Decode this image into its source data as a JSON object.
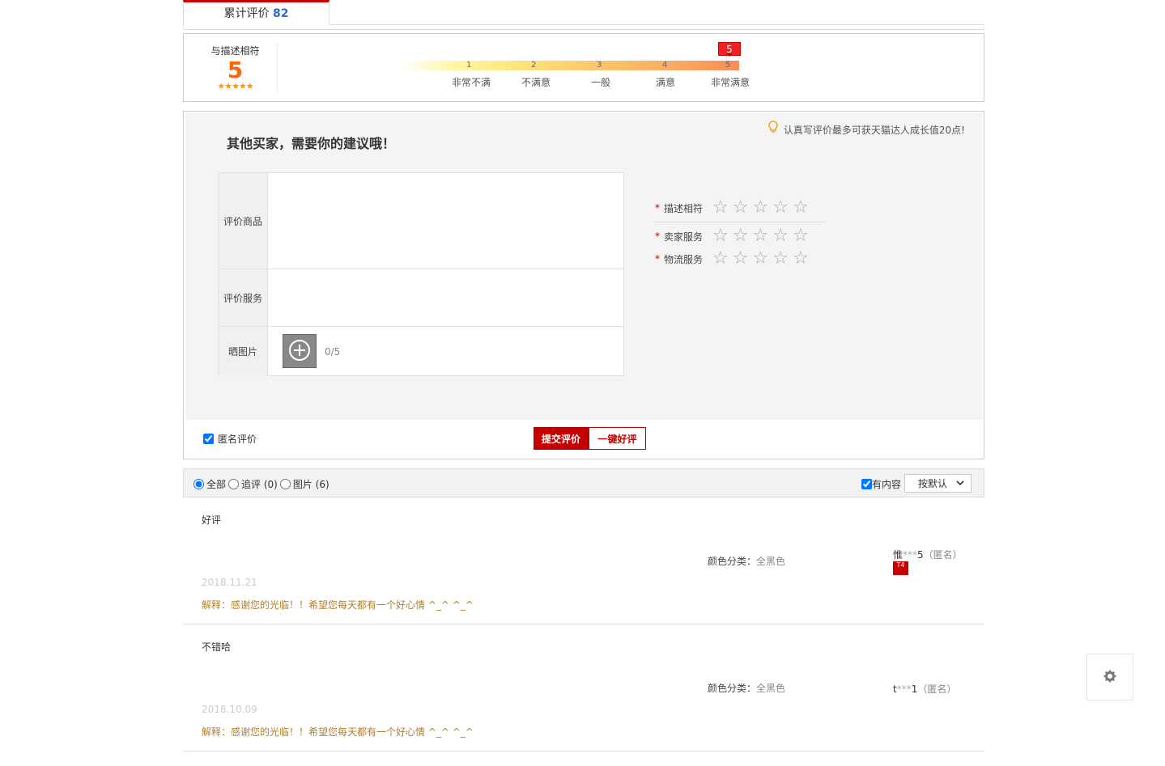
{
  "tab": {
    "label": "累计评价",
    "count": "82"
  },
  "score": {
    "label": "与描述相符",
    "value": "5",
    "stars": "★★★★★",
    "marker": "5",
    "scale_numbers": [
      "1",
      "2",
      "3",
      "4",
      "5"
    ],
    "scale_labels": [
      "非常不满",
      "不满意",
      "一般",
      "满意",
      "非常满意"
    ]
  },
  "form": {
    "title": "其他买家，需要你的建议哦！",
    "tip": "认真写评价最多可获天猫达人成长值20点!",
    "rows": {
      "product": "评价商品",
      "service": "评价服务",
      "photos": "晒图片"
    },
    "photo_count": "0/5",
    "ratings": [
      "描述相符",
      "卖家服务",
      "物流服务"
    ],
    "required_mark": "*",
    "star_glyph": "☆",
    "anonymous": "匿名评价",
    "submit": "提交评价",
    "one_click": "一键好评"
  },
  "filters": {
    "all": "全部",
    "append": "追评 (0)",
    "images": "图片 (6)",
    "has_content": "有内容",
    "sort": "按默认"
  },
  "reviews": [
    {
      "content": "好评",
      "date": "2018.11.21",
      "reply": "解释：感谢您的光临！！希望您每天都有一个好心情 ^_^ ^_^",
      "sku_key": "颜色分类：",
      "sku_val": "全黑色",
      "user_a": "惟",
      "user_mask": "***",
      "user_b": "5",
      "anon": "（匿名）",
      "badge": "T4"
    },
    {
      "content": "不错哈",
      "date": "2018.10.09",
      "reply": "解释：感谢您的光临！！希望您每天都有一个好心情 ^_^ ^_^",
      "sku_key": "颜色分类：",
      "sku_val": "全黑色",
      "user_a": "t",
      "user_mask": "***",
      "user_b": "1",
      "anon": "（匿名）"
    }
  ],
  "colors": {
    "accent": "#c40000",
    "score": "#ff6600",
    "reply": "#b08030"
  }
}
